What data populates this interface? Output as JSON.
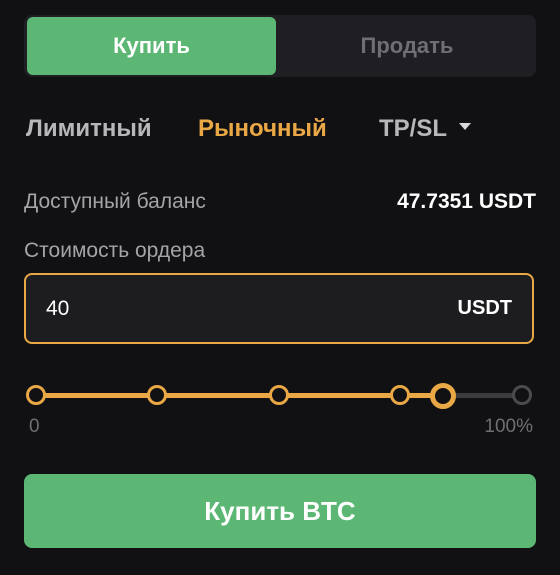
{
  "tabs": {
    "buy_label": "Купить",
    "sell_label": "Продать"
  },
  "order_types": {
    "limit": "Лимитный",
    "market": "Рыночный",
    "tpsl": "TP/SL"
  },
  "balance": {
    "label": "Доступный баланс",
    "value": "47.7351 USDT"
  },
  "order_cost": {
    "label": "Стоимость ордера",
    "value": "40",
    "unit": "USDT"
  },
  "slider": {
    "min_label": "0",
    "max_label": "100%",
    "percent": 0.84
  },
  "submit": {
    "label": "Купить BTC"
  },
  "colors": {
    "buy": "#5cb774",
    "accent": "#e9a845",
    "background": "#111114"
  }
}
